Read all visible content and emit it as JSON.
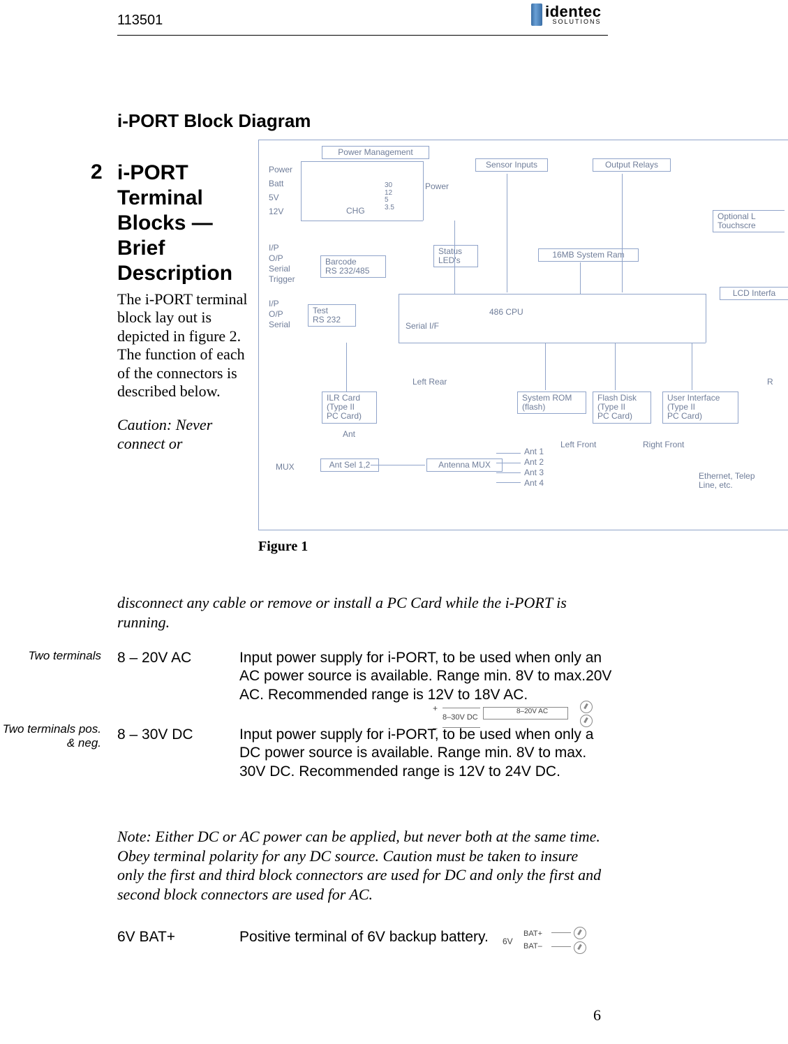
{
  "header": {
    "doc_number": "113501",
    "logo_top": "identec",
    "logo_bottom": "SOLUTIONS"
  },
  "section_title": "i-PORT Block Diagram",
  "chapter": {
    "number": "2",
    "title": "i-PORT Terminal Blocks — Brief Description",
    "intro": "The i-PORT terminal block lay out is depicted in figure 2. The function of each of the connectors is described below.",
    "caution_start": "Caution: Never connect or",
    "caution_cont": "disconnect any cable or remove or install a PC Card while the i-PORT is running."
  },
  "figure_caption": "Figure 1",
  "diagram": {
    "power_mgmt": "Power Management",
    "power": "Power",
    "batt": "Batt",
    "v5": "5V",
    "v12": "12V",
    "chg": "CHG",
    "chg_vals": "30\n12\n5\n3.5",
    "power2": "Power",
    "sensor_inputs": "Sensor Inputs",
    "output_relays": "Output Relays",
    "ip": "I/P",
    "op": "O/P",
    "serial": "Serial",
    "trigger": "Trigger",
    "barcode": "Barcode\nRS 232/485",
    "status_leds": "Status\nLED's",
    "ram": "16MB System Ram",
    "optional": "Optional L\nTouchscre",
    "lcd": "LCD Interfa",
    "ip2": "I/P",
    "op2": "O/P",
    "serial2": "Serial",
    "test_rs": "Test\nRS 232",
    "serial_if": "Serial I/F",
    "cpu": "486 CPU",
    "left_rear": "Left Rear",
    "ilr_card": "ILR Card\n(Type II\nPC Card)",
    "ant": "Ant",
    "sys_rom": "System ROM\n(flash)",
    "flash_disk": "Flash Disk\n(Type II\nPC Card)",
    "user_if": "User Interface\n(Type II\nPC Card)",
    "left_front": "Left Front",
    "right_front": "Right Front",
    "mux": "MUX",
    "ant_sel": "Ant Sel 1,2",
    "ant_mux": "Antenna MUX",
    "ant1": "Ant 1",
    "ant2": "Ant 2",
    "ant3": "Ant 3",
    "ant4": "Ant 4",
    "ethernet": "Ethernet, Telep\nLine, etc.",
    "r": "R"
  },
  "margin": {
    "note1": "Two terminals",
    "note2": "Two terminals pos. & neg."
  },
  "rows": [
    {
      "label": "8 – 20V AC",
      "desc": "Input power supply for i-PORT, to be used when only an AC power source is available. Range min. 8V to max.20V AC. Recommended range is 12V to 18V AC."
    },
    {
      "label": "8 – 30V DC",
      "desc": "Input power supply for i-PORT, to be used when only a DC power source is available. Range min. 8V to max. 30V DC. Recommended range is 12V to 24V DC."
    },
    {
      "label": "6V BAT+",
      "desc": "Positive terminal of 6V backup battery."
    }
  ],
  "note": "Note: Either DC or AC power can be applied, but never both at the same time. Obey terminal polarity for any DC source. Caution must be taken to insure only the first and third block connectors are used for DC and only the first and second block connectors are used for AC.",
  "small_power": {
    "plus": "+",
    "minus": "–",
    "dc": "8–30V DC",
    "ac": "8–20V AC"
  },
  "small_bat": {
    "v6": "6V",
    "bplus": "BAT+",
    "bminus": "BAT–"
  },
  "page_number": "6"
}
